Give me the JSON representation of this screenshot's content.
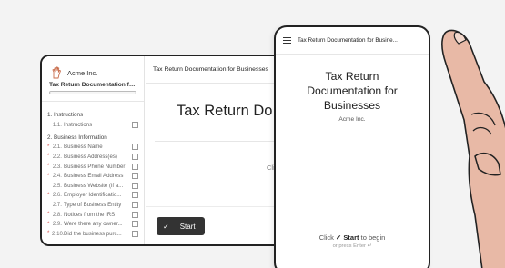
{
  "back": {
    "company": "Acme Inc.",
    "doc_title": "Tax Return Documentation for ...",
    "header_title": "Tax Return Documentation for Businesses",
    "main_title": "Tax Return Do",
    "click_text": "Clic",
    "start_button": "Start",
    "toc": [
      {
        "section": "1. Instructions",
        "items": [
          {
            "num": "1.1.",
            "label": "Instructions",
            "required": false
          }
        ]
      },
      {
        "section": "2. Business Information",
        "items": [
          {
            "num": "2.1.",
            "label": "Business Name",
            "required": true
          },
          {
            "num": "2.2.",
            "label": "Business Address(es)",
            "required": true
          },
          {
            "num": "2.3.",
            "label": "Business Phone Number",
            "required": true
          },
          {
            "num": "2.4.",
            "label": "Business Email Address",
            "required": true
          },
          {
            "num": "2.5.",
            "label": "Business Website (if a...",
            "required": false
          },
          {
            "num": "2.6.",
            "label": "Employer Identificatio...",
            "required": true
          },
          {
            "num": "2.7.",
            "label": "Type of Business Entity",
            "required": false
          },
          {
            "num": "2.8.",
            "label": "Notices from the IRS",
            "required": true
          },
          {
            "num": "2.9.",
            "label": "Were there any owner...",
            "required": true
          },
          {
            "num": "2.10.",
            "label": "Did the business purc...",
            "required": true
          }
        ]
      }
    ]
  },
  "phone": {
    "header_title": "Tax Return Documentation for Busine...",
    "title": "Tax Return Documentation for Businesses",
    "company": "Acme Inc.",
    "click_prefix": "Click",
    "check_glyph": "✓",
    "start_word": "Start",
    "click_suffix": "to begin",
    "enter_hint": "or press Enter ↵"
  },
  "colors": {
    "accent": "#333333",
    "required": "#d9534f",
    "logo": "#c86b4a",
    "skin": "#e8b9a6"
  },
  "icons": [
    "hand-logo-icon",
    "menu-icon",
    "check-icon"
  ]
}
